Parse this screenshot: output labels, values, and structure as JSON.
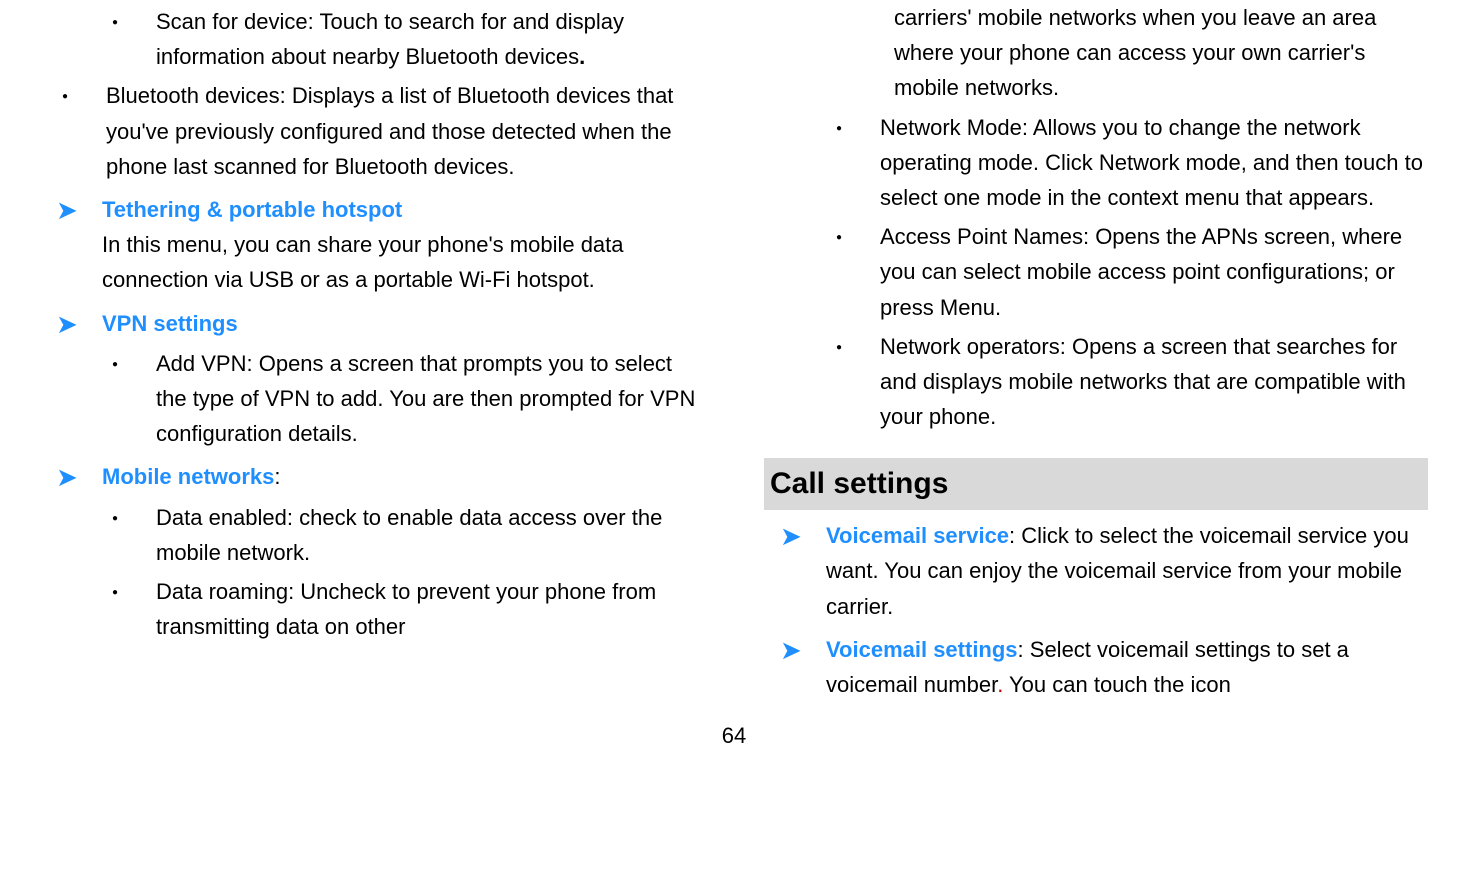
{
  "left": {
    "scan": "Scan for device: Touch to search for and display information about nearby Bluetooth devices",
    "scanPeriod": ".",
    "btDevices": "Bluetooth devices: Displays a list of Bluetooth devices that you've previously configured and those detected when the phone last scanned for Bluetooth devices.",
    "tetherTitle": "Tethering & portable hotspot",
    "tetherBody": "In this menu, you can share your phone's mobile data connection via USB or as a portable Wi-Fi hotspot.",
    "vpnTitle": "VPN settings",
    "vpnAdd": "Add VPN: Opens a screen that prompts you to select the type of VPN to add. You are then prompted for VPN configuration details.",
    "mobileTitle": "Mobile networks",
    "mobileColon": ":",
    "dataEnabled": "Data enabled: check to enable data access over the mobile network.",
    "dataRoaming": "Data roaming: Uncheck to prevent your phone from transmitting data on other"
  },
  "right": {
    "roamingCont": "carriers' mobile networks when you leave an area where your phone can access your own carrier's mobile networks.",
    "netMode": "Network Mode: Allows you to change the network operating mode. Click Network mode, and then touch to select one mode in the context menu that appears.",
    "apn": "Access Point Names: Opens the APNs screen, where you can select mobile access point configurations; or press Menu.",
    "netOps": "Network operators: Opens a screen that searches for and displays mobile networks that are compatible with your phone.",
    "callHeading": "Call settings",
    "vmServiceTitle": "Voicemail service",
    "vmServiceBody": ": Click to select the voicemail service you want. You can enjoy the voicemail service from your mobile carrier.",
    "vmSettingsTitle": "Voicemail settings",
    "vmSettingsBody1": ": Select voicemail settings to set a voicemail number",
    "vmSettingsDot": ". ",
    "vmSettingsBody2": "You can touch the icon"
  },
  "pageNumber": "64"
}
